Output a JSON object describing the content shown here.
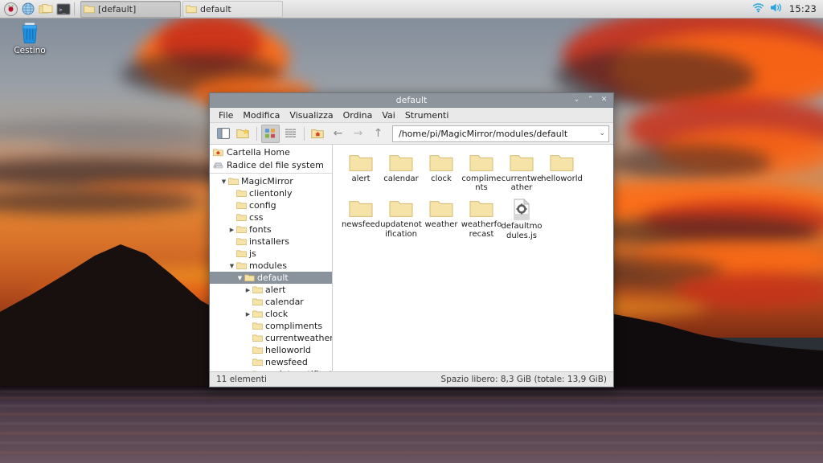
{
  "taskbar": {
    "launchers": [
      {
        "name": "raspberry-menu-icon",
        "label": "Menu"
      },
      {
        "name": "web-browser-icon",
        "label": "Web Browser"
      },
      {
        "name": "file-manager-icon",
        "label": "File Manager"
      },
      {
        "name": "terminal-icon",
        "label": "Terminal"
      }
    ],
    "tasks": [
      {
        "label": "[default]",
        "state": "active"
      },
      {
        "label": "default",
        "state": "inactive"
      }
    ],
    "tray": {
      "wifi_icon": "wifi-icon",
      "volume_icon": "volume-icon",
      "clock": "15:23"
    }
  },
  "desktop": {
    "icons": [
      {
        "name": "trash-icon",
        "label": "Cestino"
      }
    ]
  },
  "window": {
    "title": "default",
    "buttons": {
      "minimize": "⌄",
      "maximize": "⌃",
      "close": "✕"
    },
    "menu": [
      "File",
      "Modifica",
      "Visualizza",
      "Ordina",
      "Vai",
      "Strumenti"
    ],
    "toolbar": {
      "sidebar_toggle": "sidebar-toggle-icon",
      "new_folder": "new-folder-icon",
      "icon_view": "icon-view-icon",
      "list_view": "list-view-icon",
      "home": "home-icon",
      "back": "←",
      "forward": "→",
      "up": "↑"
    },
    "path": "/home/pi/MagicMirror/modules/default",
    "path_dropdown": "⌄",
    "sidebar": {
      "places": [
        {
          "label": "Cartella Home",
          "icon": "home-folder-icon"
        },
        {
          "label": "Radice del file system",
          "icon": "drive-icon"
        }
      ],
      "tree": [
        {
          "label": "MagicMirror",
          "depth": 2,
          "twisty": "open",
          "selected": false
        },
        {
          "label": "clientonly",
          "depth": 3,
          "twisty": "none",
          "selected": false
        },
        {
          "label": "config",
          "depth": 3,
          "twisty": "none",
          "selected": false
        },
        {
          "label": "css",
          "depth": 3,
          "twisty": "none",
          "selected": false
        },
        {
          "label": "fonts",
          "depth": 3,
          "twisty": "closed",
          "selected": false
        },
        {
          "label": "installers",
          "depth": 3,
          "twisty": "none",
          "selected": false
        },
        {
          "label": "js",
          "depth": 3,
          "twisty": "none",
          "selected": false
        },
        {
          "label": "modules",
          "depth": 3,
          "twisty": "open",
          "selected": false
        },
        {
          "label": "default",
          "depth": 4,
          "twisty": "open",
          "selected": true
        },
        {
          "label": "alert",
          "depth": 5,
          "twisty": "closed",
          "selected": false
        },
        {
          "label": "calendar",
          "depth": 5,
          "twisty": "none",
          "selected": false
        },
        {
          "label": "clock",
          "depth": 5,
          "twisty": "closed",
          "selected": false
        },
        {
          "label": "compliments",
          "depth": 5,
          "twisty": "none",
          "selected": false
        },
        {
          "label": "currentweather",
          "depth": 5,
          "twisty": "none",
          "selected": false
        },
        {
          "label": "helloworld",
          "depth": 5,
          "twisty": "none",
          "selected": false
        },
        {
          "label": "newsfeed",
          "depth": 5,
          "twisty": "none",
          "selected": false
        },
        {
          "label": "updatenotification",
          "depth": 5,
          "twisty": "none",
          "selected": false
        }
      ]
    },
    "files": [
      {
        "name": "alert",
        "type": "folder"
      },
      {
        "name": "calendar",
        "type": "folder"
      },
      {
        "name": "clock",
        "type": "folder"
      },
      {
        "name": "compliments",
        "type": "folder"
      },
      {
        "name": "currentweather",
        "type": "folder"
      },
      {
        "name": "helloworld",
        "type": "folder"
      },
      {
        "name": "newsfeed",
        "type": "folder"
      },
      {
        "name": "updatenotification",
        "type": "folder"
      },
      {
        "name": "weather",
        "type": "folder"
      },
      {
        "name": "weatherforecast",
        "type": "folder"
      },
      {
        "name": "defaultmodules.js",
        "type": "script"
      }
    ],
    "status": {
      "items": "11 elementi",
      "space": "Spazio libero: 8,3 GiB (totale: 13,9 GiB)"
    }
  },
  "colors": {
    "titlebar": "#8d949c",
    "selection": "#8a929c",
    "folder": "#f5e3a8",
    "taskbar": "#e2e2e2"
  }
}
